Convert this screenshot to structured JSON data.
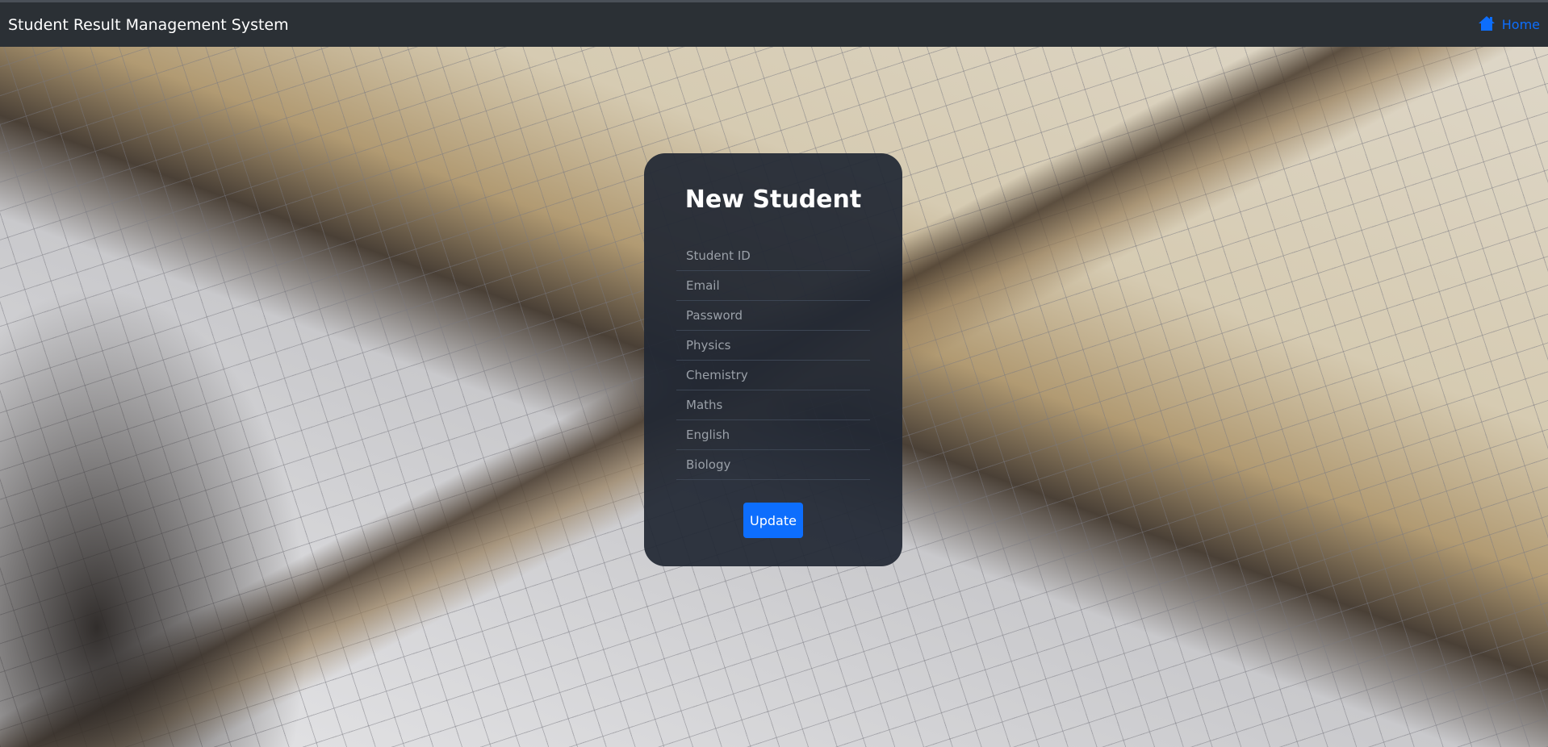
{
  "navbar": {
    "brand": "Student Result Management System",
    "home_label": "Home",
    "home_icon": "home-icon"
  },
  "form": {
    "title": "New Student",
    "fields": [
      {
        "name": "student-id",
        "placeholder": "Student ID"
      },
      {
        "name": "email",
        "placeholder": "Email"
      },
      {
        "name": "password",
        "placeholder": "Password"
      },
      {
        "name": "physics",
        "placeholder": "Physics"
      },
      {
        "name": "chemistry",
        "placeholder": "Chemistry"
      },
      {
        "name": "maths",
        "placeholder": "Maths"
      },
      {
        "name": "english",
        "placeholder": "English"
      },
      {
        "name": "biology",
        "placeholder": "Biology"
      }
    ],
    "submit_label": "Update"
  },
  "colors": {
    "accent": "#0d6efd",
    "navbar": "#2b3035"
  }
}
